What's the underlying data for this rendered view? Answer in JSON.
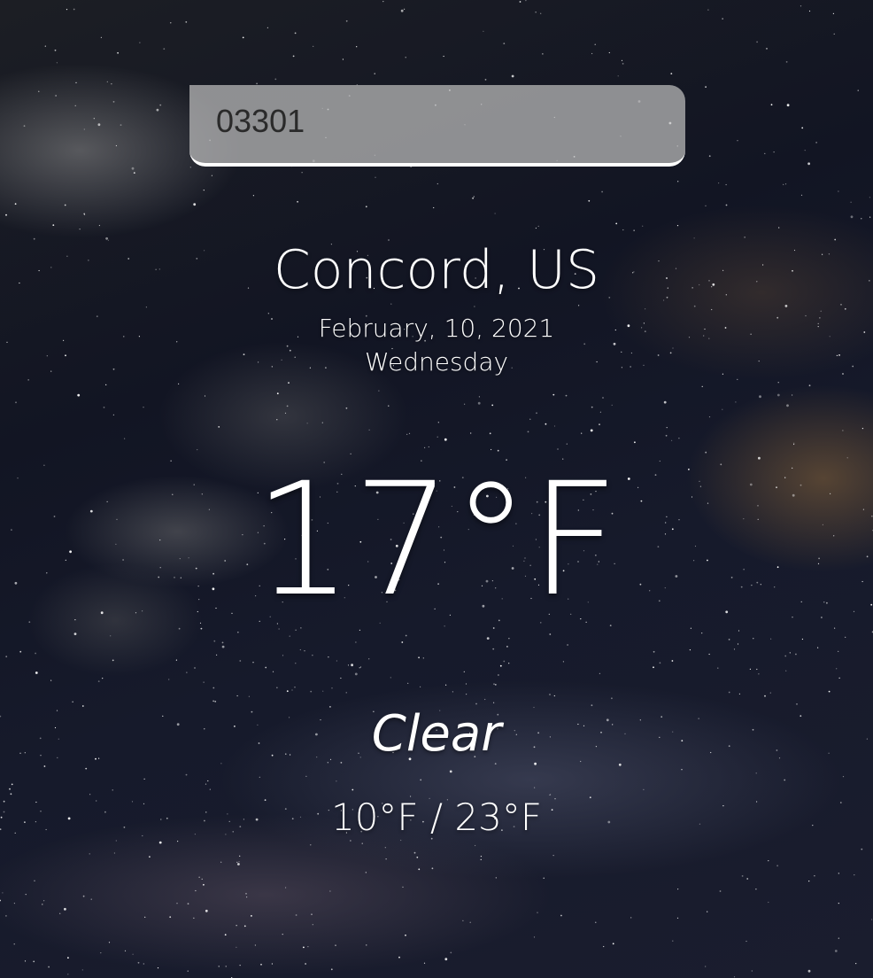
{
  "search": {
    "value": "03301",
    "placeholder": ""
  },
  "location": {
    "name": "Concord, US"
  },
  "date": {
    "full": "February, 10, 2021",
    "weekday": "Wednesday"
  },
  "weather": {
    "temperature": "17°F",
    "condition": "Clear",
    "range": "10°F / 23°F"
  },
  "colors": {
    "text": "#ffffff",
    "search_bg": "#bebebe",
    "search_text": "#2a2a2a",
    "sky": "#121523"
  }
}
